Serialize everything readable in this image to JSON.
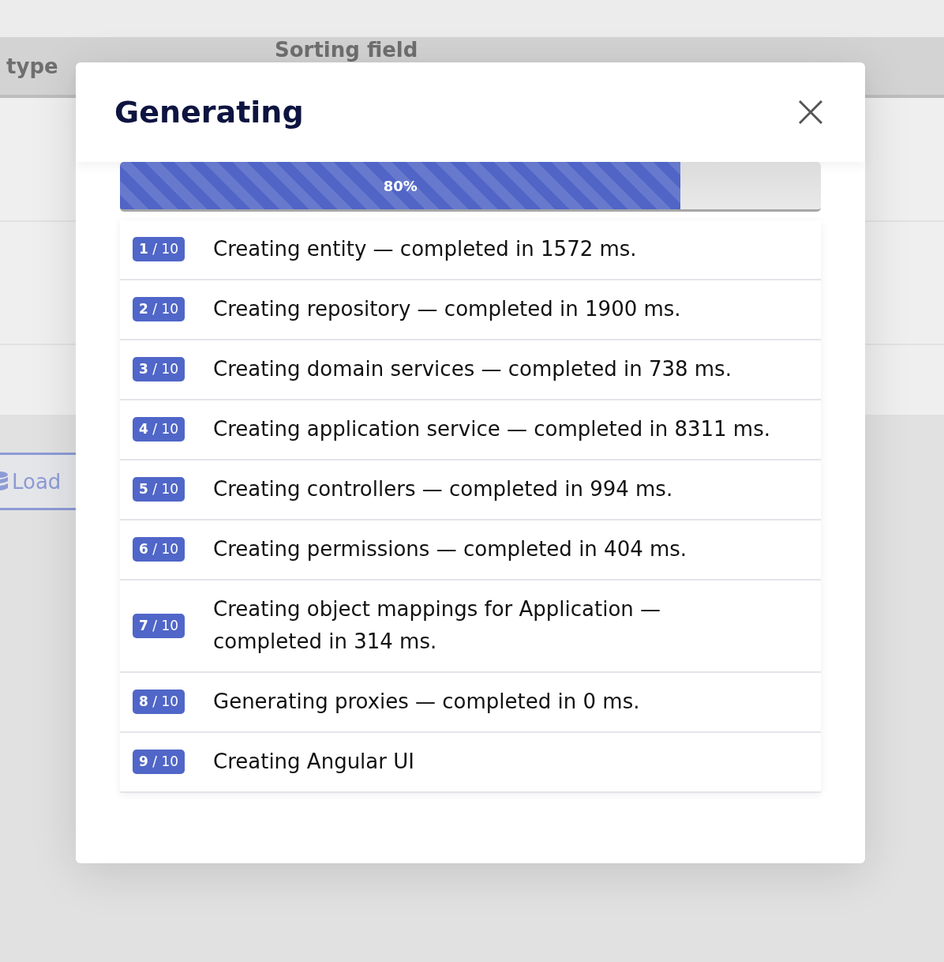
{
  "background": {
    "table": {
      "columns": [
        "type",
        "Sorting field"
      ]
    },
    "load_button": {
      "label": "Load"
    }
  },
  "modal": {
    "title": "Generating",
    "progress": {
      "level": 0.8,
      "label": "80%"
    },
    "steps": [
      {
        "badge": "**1** / 10",
        "message": "Creating entity — completed in 1572 ms."
      },
      {
        "badge": "**2** / 10",
        "message": "Creating repository — completed in 1900 ms."
      },
      {
        "badge": "**3** / 10",
        "message": "Creating domain services — completed in 738 ms."
      },
      {
        "badge": "**4** / 10",
        "message": "Creating application service — completed in 8311 ms."
      },
      {
        "badge": "**5** / 10",
        "message": "Creating controllers — completed in 994 ms."
      },
      {
        "badge": "**6** / 10",
        "message": "Creating permissions — completed in 404 ms."
      },
      {
        "badge": "**7** / 10",
        "message": "Creating object mappings for Application — completed in 314 ms."
      },
      {
        "badge": "**8** / 10",
        "message": "Generating proxies — completed in 0 ms."
      },
      {
        "badge": "**9** / 10",
        "message": "Creating Angular UI"
      }
    ]
  }
}
